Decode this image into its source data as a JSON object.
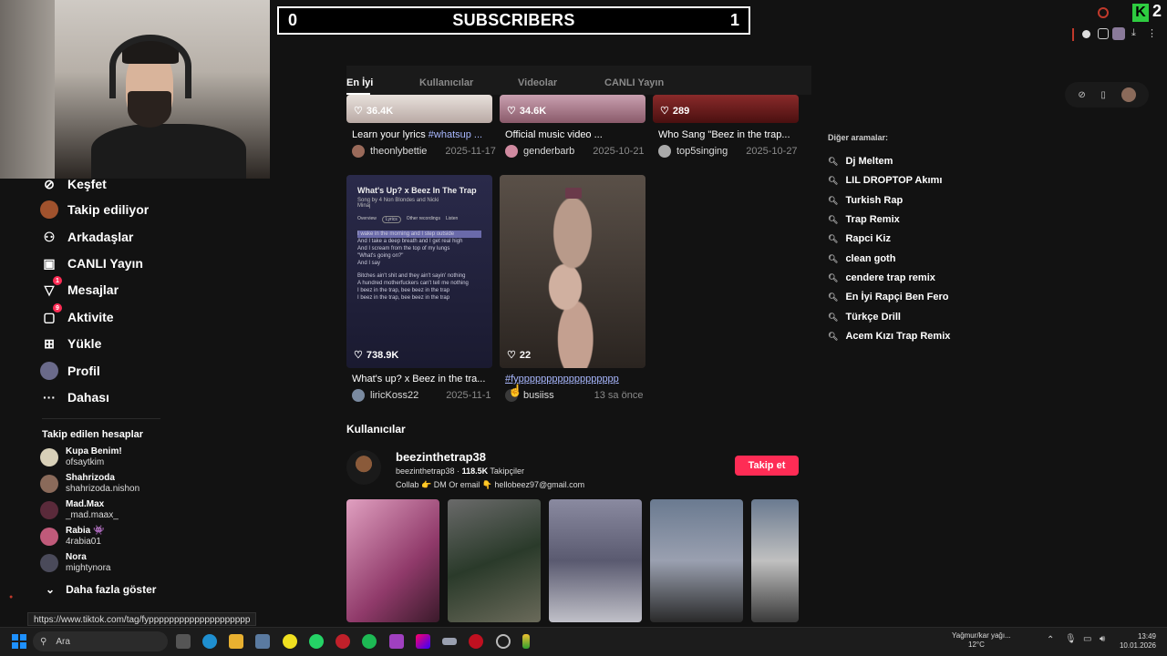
{
  "subscriber_bar": {
    "left_count": "0",
    "title": "SUBSCRIBERS",
    "right_count": "1"
  },
  "top_right": {
    "k_label": "K",
    "k_count": "2"
  },
  "sidebar": {
    "items": [
      {
        "label": "Keşfet",
        "icon": "compass-icon"
      },
      {
        "label": "Takip ediliyor",
        "icon": "avatar-icon"
      },
      {
        "label": "Arkadaşlar",
        "icon": "friends-icon"
      },
      {
        "label": "CANLI Yayın",
        "icon": "live-icon"
      },
      {
        "label": "Mesajlar",
        "icon": "messages-icon",
        "badge": "1"
      },
      {
        "label": "Aktivite",
        "icon": "activity-icon",
        "badge": "9"
      },
      {
        "label": "Yükle",
        "icon": "upload-icon"
      },
      {
        "label": "Profil",
        "icon": "profile-icon"
      },
      {
        "label": "Dahası",
        "icon": "more-icon"
      }
    ],
    "following_heading": "Takip edilen hesaplar",
    "following": [
      {
        "name": "Kupa Benim!",
        "handle": "ofsaytkim"
      },
      {
        "name": "Shahrizoda",
        "handle": "shahrizoda.nishon"
      },
      {
        "name": "Mad.Max",
        "handle": "_mad.maax_"
      },
      {
        "name": "Rabia 👾",
        "handle": "4rabia01"
      },
      {
        "name": "Nora",
        "handle": "mightynora"
      }
    ],
    "show_more": "Daha fazla göster"
  },
  "status_url": "https://www.tiktok.com/tag/fypppppppppppppppppppp",
  "tabs": [
    "En İyi",
    "Kullanıcılar",
    "Videolar",
    "CANLI Yayın"
  ],
  "videos_row1": [
    {
      "likes": "36.4K",
      "caption": "Learn your lyrics ",
      "tag": "#whatsup ...",
      "author": "theonlybettie",
      "date": "2025-11-17"
    },
    {
      "likes": "34.6K",
      "caption": "Official music video ...",
      "tag": "",
      "author": "genderbarb",
      "date": "2025-10-21"
    },
    {
      "likes": "289",
      "caption": "Who Sang \"Beez in the trap...",
      "tag": "",
      "author": "top5singing",
      "date": "2025-10-27"
    }
  ],
  "videos_row2": [
    {
      "likes": "738.9K",
      "caption": "What's up? x Beez in the tra...",
      "tag": "",
      "author": "liricKoss22",
      "date": "2025-11-1"
    },
    {
      "likes": "22",
      "caption": "",
      "tag": "#fypppppppppppppppppp",
      "author": "busiiss",
      "date": "13 sa önce"
    }
  ],
  "lyric_card": {
    "title": "What's Up? x Beez In The Trap",
    "subtitle": "Song by 4 Non Blondes and Nicki Minaj",
    "tabs": [
      "Overview",
      "Lyrics",
      "Other recordings",
      "Listen"
    ],
    "lines": [
      "I wake in the morning and I step outside",
      "And I take a deep breath and I get real high",
      "And I scream from the top of my lungs",
      "\"What's going on?\"",
      "And I say",
      "",
      "Bitches ain't shit and they ain't sayin' nothing",
      "A hundred motherfuckers can't tell me nothing",
      "I beez in the trap, bee beez in the trap",
      "I beez in the trap, bee beez in the trap"
    ]
  },
  "users_section": {
    "heading": "Kullanıcılar",
    "name": "beezinthetrap38",
    "handle": "beezinthetrap38 · ",
    "followers": "118.5K",
    "followers_label": " Takipçiler",
    "bio": "Collab 👉 DM Or email 👇 hellobeez97@gmail.com",
    "follow_button": "Takip et"
  },
  "other_searches": {
    "heading": "Diğer aramalar:",
    "items": [
      "Dj Meltem",
      "LIL DROPTOP Akımı",
      "Turkish Rap",
      "Trap Remix",
      "Rapci Kiz",
      "clean goth",
      "cendere trap remix",
      "En İyi Rapçi Ben Fero",
      "Türkçe Drill",
      "Acem Kızı Trap Remix"
    ]
  },
  "taskbar": {
    "search_placeholder": "Ara",
    "weather_line1": "Yağmur/kar yağı...",
    "weather_line2": "12°C",
    "time": "13:49",
    "date": "10.01.2026"
  },
  "colors": {
    "accent": "#fe2c55",
    "background": "#121212",
    "hashtag": "#a9b8ff"
  }
}
